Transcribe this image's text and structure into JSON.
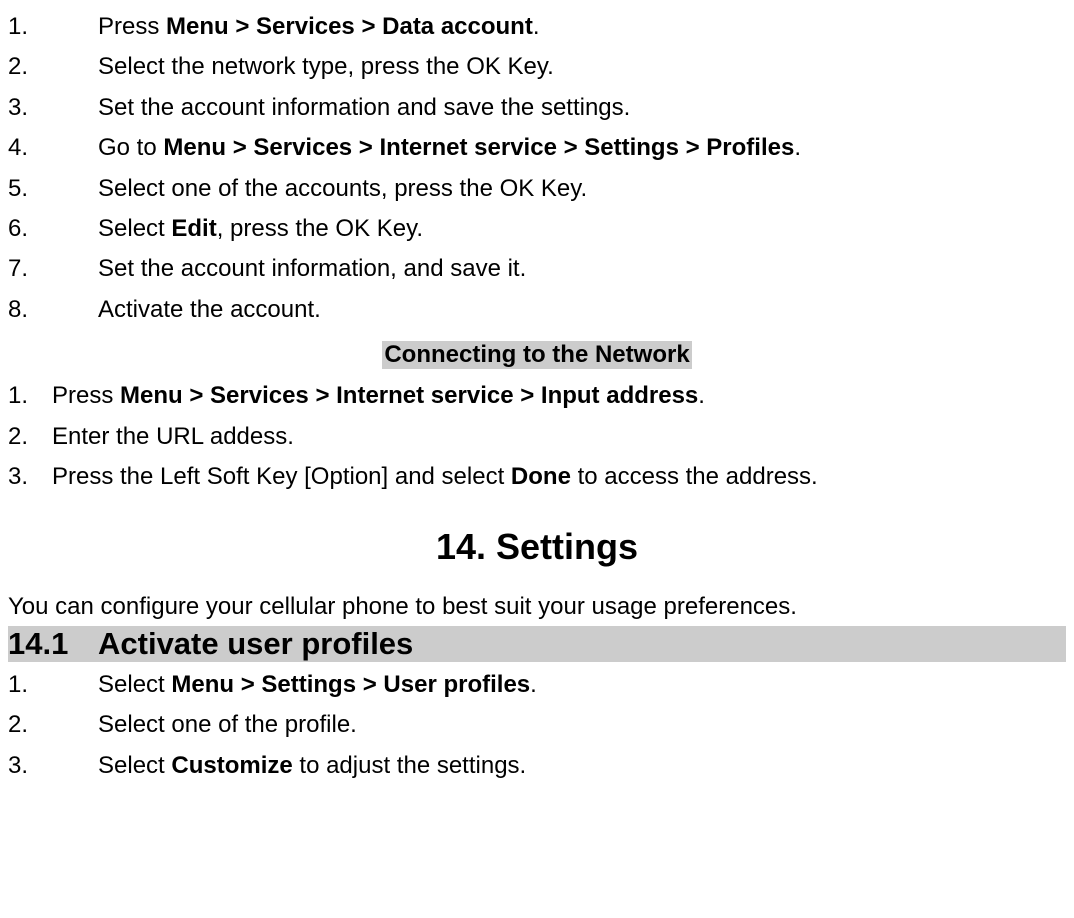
{
  "listA": [
    {
      "n": "1.",
      "pre": "Press ",
      "bold": "Menu > Services > Data account",
      "post": "."
    },
    {
      "n": "2.",
      "pre": "Select the network type, press the OK Key.",
      "bold": "",
      "post": ""
    },
    {
      "n": "3.",
      "pre": "Set the account information and save the settings.",
      "bold": "",
      "post": ""
    },
    {
      "n": "4.",
      "pre": "Go to ",
      "bold": "Menu > Services > Internet service > Settings > Profiles",
      "post": "."
    },
    {
      "n": "5.",
      "pre": "Select one of the accounts, press the OK Key.",
      "bold": "",
      "post": ""
    },
    {
      "n": "6.",
      "pre": "Select ",
      "bold": "Edit",
      "post": ", press the OK Key."
    },
    {
      "n": "7.",
      "pre": "Set the account information, and save it.",
      "bold": "",
      "post": ""
    },
    {
      "n": "8.",
      "pre": "Activate the account.",
      "bold": "",
      "post": ""
    }
  ],
  "subheading1": "Connecting to the Network",
  "listB": [
    {
      "n": "1.",
      "pre": "Press ",
      "bold": "Menu > Services > Internet service > Input address",
      "post": "."
    },
    {
      "n": "2.",
      "pre": "Enter the URL addess.",
      "bold": "",
      "post": ""
    },
    {
      "n": "3.",
      "pre": "Press the Left Soft Key [Option] and select ",
      "bold": "Done",
      "post": " to access the address."
    }
  ],
  "h1": "14. Settings",
  "intro": "You can configure your cellular phone to best suit your usage preferences.",
  "sec": {
    "num": "14.1",
    "title": "Activate user profiles"
  },
  "listC": [
    {
      "n": "1.",
      "pre": "Select ",
      "bold": "Menu > Settings > User profiles",
      "post": "."
    },
    {
      "n": "2.",
      "pre": "Select one of the profile.",
      "bold": "",
      "post": ""
    },
    {
      "n": "3.",
      "pre": "Select ",
      "bold": "Customize",
      "post": " to adjust the settings."
    }
  ]
}
